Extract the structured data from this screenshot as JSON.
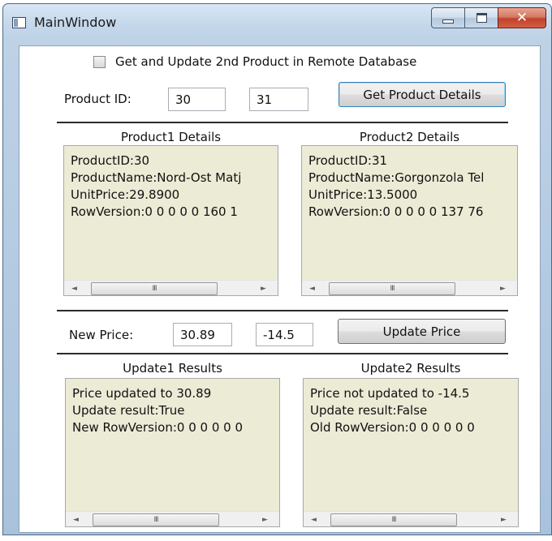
{
  "window": {
    "title": "MainWindow"
  },
  "icons": {
    "app": "app-window-icon",
    "minimize": "minimize-icon",
    "maximize": "maximize-icon",
    "close": "close-icon"
  },
  "checkbox": {
    "label": "Get and Update 2nd Product in Remote Database",
    "checked": false
  },
  "product_id": {
    "label": "Product ID:",
    "value1": "30",
    "value2": "31"
  },
  "get_button": "Get Product Details",
  "product1": {
    "header": "Product1 Details",
    "lines": [
      "ProductID:30",
      "ProductName:Nord-Ost Matj",
      "UnitPrice:29.8900",
      "RowVersion:0 0 0 0 0 160 1"
    ]
  },
  "product2": {
    "header": "Product2 Details",
    "lines": [
      "ProductID:31",
      "ProductName:Gorgonzola Tel",
      "UnitPrice:13.5000",
      "RowVersion:0 0 0 0 0 137 76"
    ]
  },
  "new_price": {
    "label": "New Price:",
    "value1": "30.89",
    "value2": "-14.5"
  },
  "update_button": "Update Price",
  "update1": {
    "header": "Update1 Results",
    "lines": [
      "Price updated to 30.89",
      "Update result:True",
      "New RowVersion:0 0 0 0 0 0"
    ]
  },
  "update2": {
    "header": "Update2 Results",
    "lines": [
      "Price not updated to -14.5",
      "Update result:False",
      "Old RowVersion:0 0 0 0 0 0"
    ]
  },
  "scrollbar": {
    "left_arrow": "◄",
    "right_arrow": "►",
    "grip": "III"
  }
}
